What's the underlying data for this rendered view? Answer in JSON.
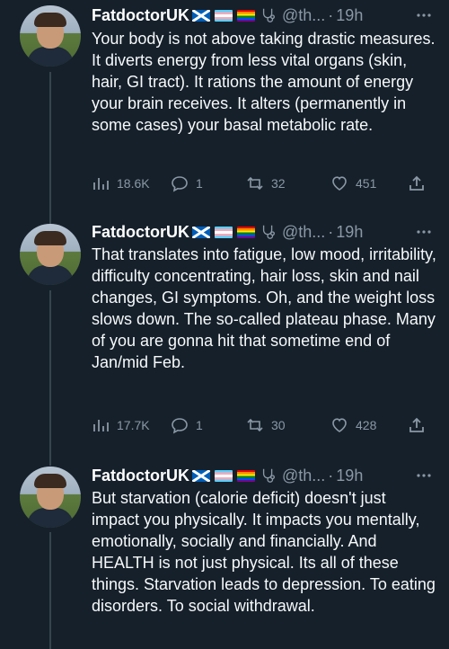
{
  "tweets": [
    {
      "author_name": "FatdoctorUK",
      "handle": "@th...",
      "separator": "·",
      "time": "19h",
      "text": "Your body is not above taking drastic measures. It diverts energy from less vital organs (skin, hair, GI tract). It rations the amount of energy your brain receives. It alters (permanently in some cases) your basal metabolic rate.",
      "views": "18.6K",
      "replies": "1",
      "retweets": "32",
      "likes": "451"
    },
    {
      "author_name": "FatdoctorUK",
      "handle": "@th...",
      "separator": "·",
      "time": "19h",
      "text": "That translates into fatigue, low mood, irritability, difficulty concentrating, hair loss, skin and nail changes, GI symptoms. Oh, and the weight loss slows down. The so-called plateau phase. Many of you are gonna hit that sometime end of Jan/mid Feb.",
      "views": "17.7K",
      "replies": "1",
      "retweets": "30",
      "likes": "428"
    },
    {
      "author_name": "FatdoctorUK",
      "handle": "@th...",
      "separator": "·",
      "time": "19h",
      "text": "But starvation (calorie deficit) doesn't just impact you physically. It impacts you mentally, emotionally, socially and financially. And HEALTH is not just physical. Its all of these things. Starvation leads to depression. To eating disorders. To social withdrawal."
    }
  ],
  "icons": [
    "scotland-flag-icon",
    "trans-flag-icon",
    "pride-flag-icon",
    "stethoscope-icon",
    "more-icon",
    "views-icon",
    "reply-icon",
    "retweet-icon",
    "like-icon",
    "share-icon"
  ],
  "colors": {
    "background": "#15202b",
    "text": "#f7f9f9",
    "secondary": "#8b98a5",
    "thread_line": "#38444d"
  }
}
